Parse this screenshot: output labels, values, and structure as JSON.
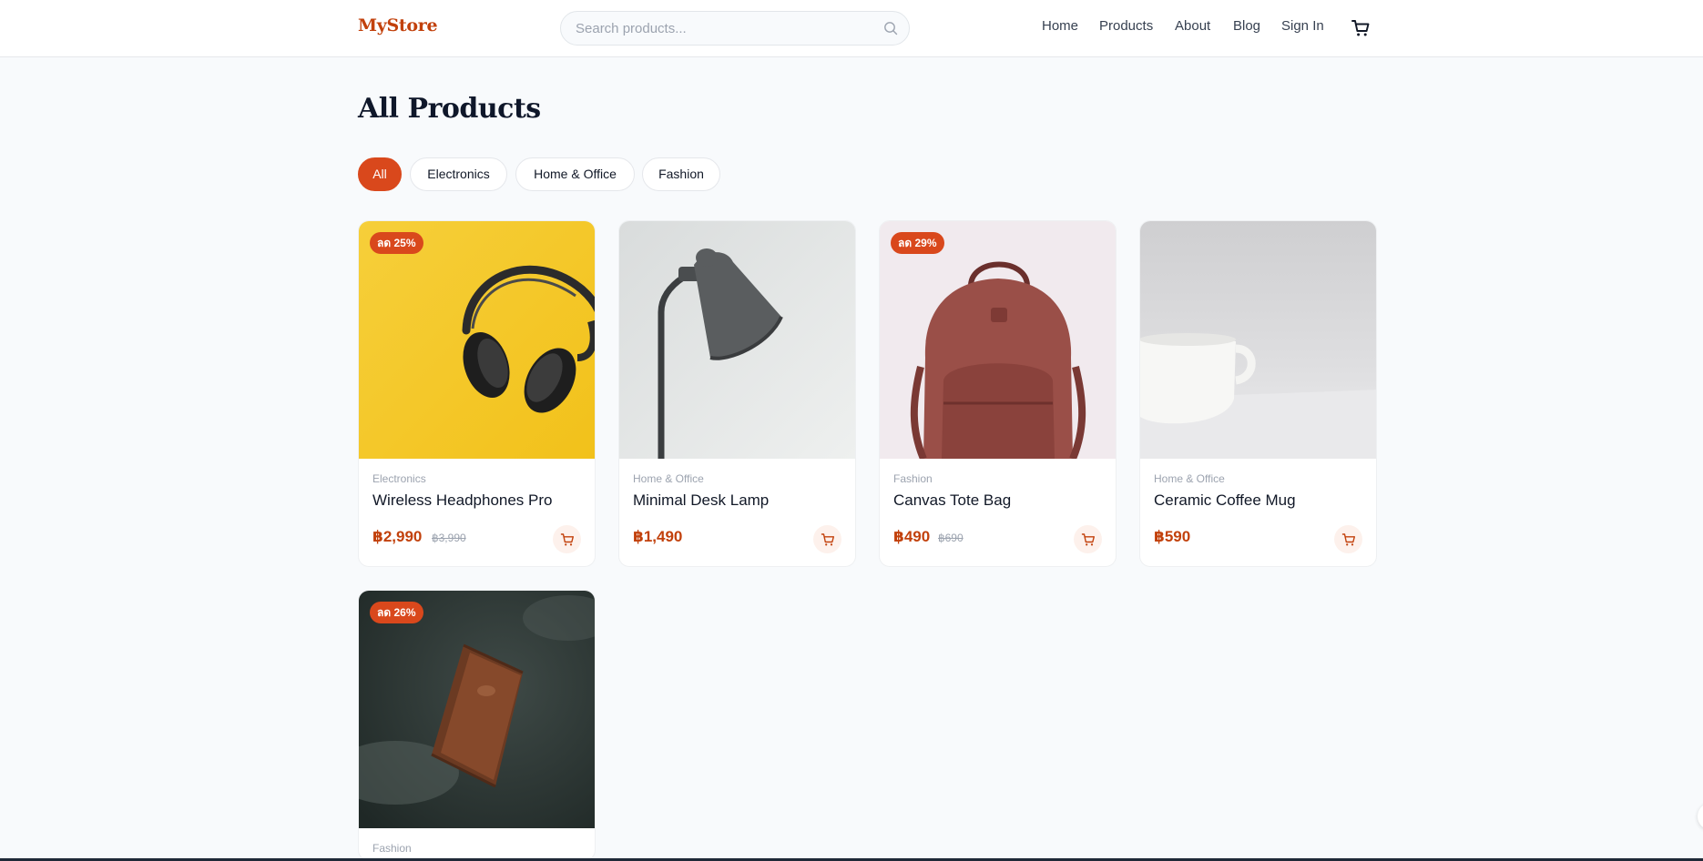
{
  "header": {
    "logo": "MyStore",
    "search_placeholder": "Search products...",
    "nav": {
      "home": "Home",
      "products": "Products",
      "about": "About",
      "blog": "Blog",
      "sign_in": "Sign In"
    },
    "cart_icon": "cart-icon"
  },
  "main": {
    "title": "All Products",
    "filters": {
      "all": "All",
      "electronics": "Electronics",
      "home_office": "Home & Office",
      "fashion": "Fashion",
      "active": "All"
    },
    "products": [
      {
        "category": "Electronics",
        "name": "Wireless Headphones Pro",
        "price": "฿2,990",
        "old_price": "฿3,990",
        "badge": "ลด 25%"
      },
      {
        "category": "Home & Office",
        "name": "Minimal Desk Lamp",
        "price": "฿1,490"
      },
      {
        "category": "Fashion",
        "name": "Canvas Tote Bag",
        "price": "฿490",
        "old_price": "฿690",
        "badge": "ลด 29%"
      },
      {
        "category": "Home & Office",
        "name": "Ceramic Coffee Mug",
        "price": "฿590"
      },
      {
        "category": "Fashion",
        "badge": "ลด 26%"
      }
    ]
  },
  "colors": {
    "accent": "#d9481c",
    "price": "#c2410c",
    "background": "#f8fafc"
  }
}
